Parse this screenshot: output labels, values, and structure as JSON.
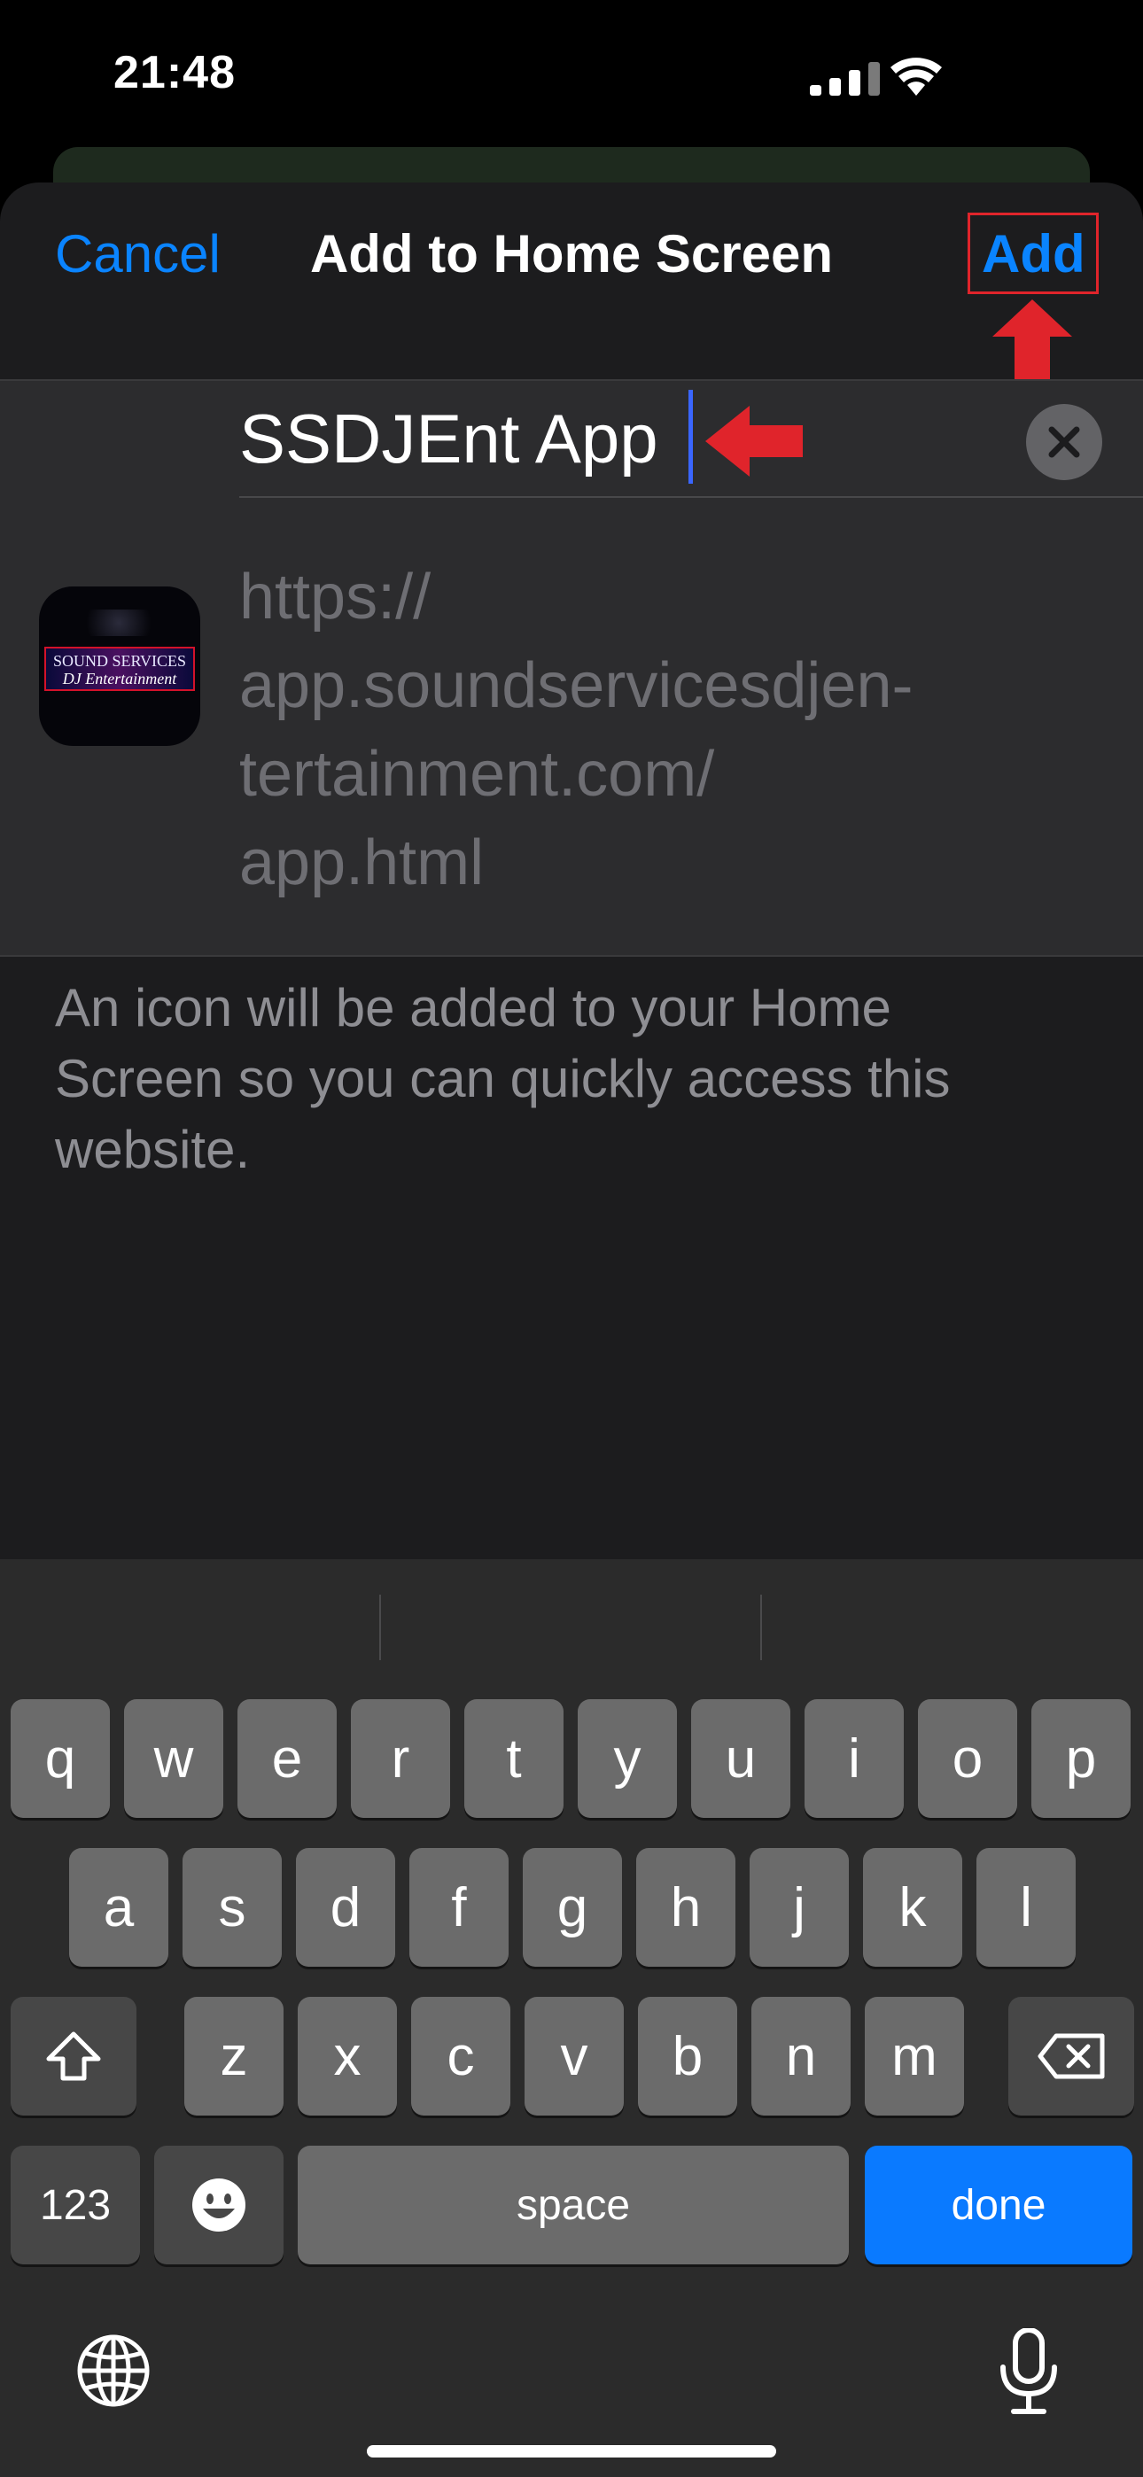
{
  "status_bar": {
    "time": "21:48"
  },
  "nav": {
    "cancel": "Cancel",
    "title": "Add to Home Screen",
    "add": "Add"
  },
  "form": {
    "name_value": "SSDJEnt App",
    "url": "https://\napp.soundservicesdjen-\ntertainment.com/\napp.html"
  },
  "app_icon": {
    "line1": "SOUND SERVICES",
    "line2": "DJ Entertainment"
  },
  "description": "An icon will be added to your Home Screen so you can quickly access this website.",
  "keyboard": {
    "row1": [
      "q",
      "w",
      "e",
      "r",
      "t",
      "y",
      "u",
      "i",
      "o",
      "p"
    ],
    "row2": [
      "a",
      "s",
      "d",
      "f",
      "g",
      "h",
      "j",
      "k",
      "l"
    ],
    "row3": [
      "z",
      "x",
      "c",
      "v",
      "b",
      "n",
      "m"
    ],
    "numbers": "123",
    "space": "space",
    "done": "done"
  },
  "colors": {
    "accent": "#0a84ff",
    "annotation": "#e0242b",
    "done_key": "#0a7aff"
  }
}
